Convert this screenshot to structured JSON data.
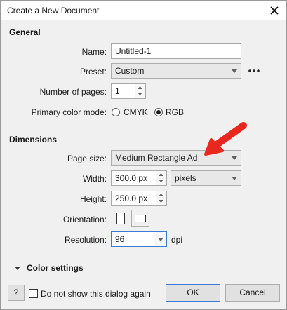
{
  "window": {
    "title": "Create a New Document"
  },
  "general": {
    "heading": "General",
    "name_label": "Name:",
    "name_value": "Untitled-1",
    "preset_label": "Preset:",
    "preset_value": "Custom",
    "pages_label": "Number of pages:",
    "pages_value": "1",
    "color_mode_label": "Primary color mode:",
    "color_modes": [
      "CMYK",
      "RGB"
    ],
    "color_mode_selected": "RGB"
  },
  "dimensions": {
    "heading": "Dimensions",
    "page_size_label": "Page size:",
    "page_size_value": "Medium Rectangle Ad",
    "width_label": "Width:",
    "width_value": "300.0 px",
    "units_value": "pixels",
    "height_label": "Height:",
    "height_value": "250.0 px",
    "orientation_label": "Orientation:",
    "resolution_label": "Resolution:",
    "resolution_value": "96",
    "resolution_unit": "dpi"
  },
  "color_settings": {
    "label": "Color settings"
  },
  "footer": {
    "help_label": "?",
    "dont_show_label": "Do not show this dialog again",
    "ok_label": "OK",
    "cancel_label": "Cancel"
  },
  "colors": {
    "annotation_arrow": "#e8281e",
    "focus_border": "#3a7bd5"
  }
}
